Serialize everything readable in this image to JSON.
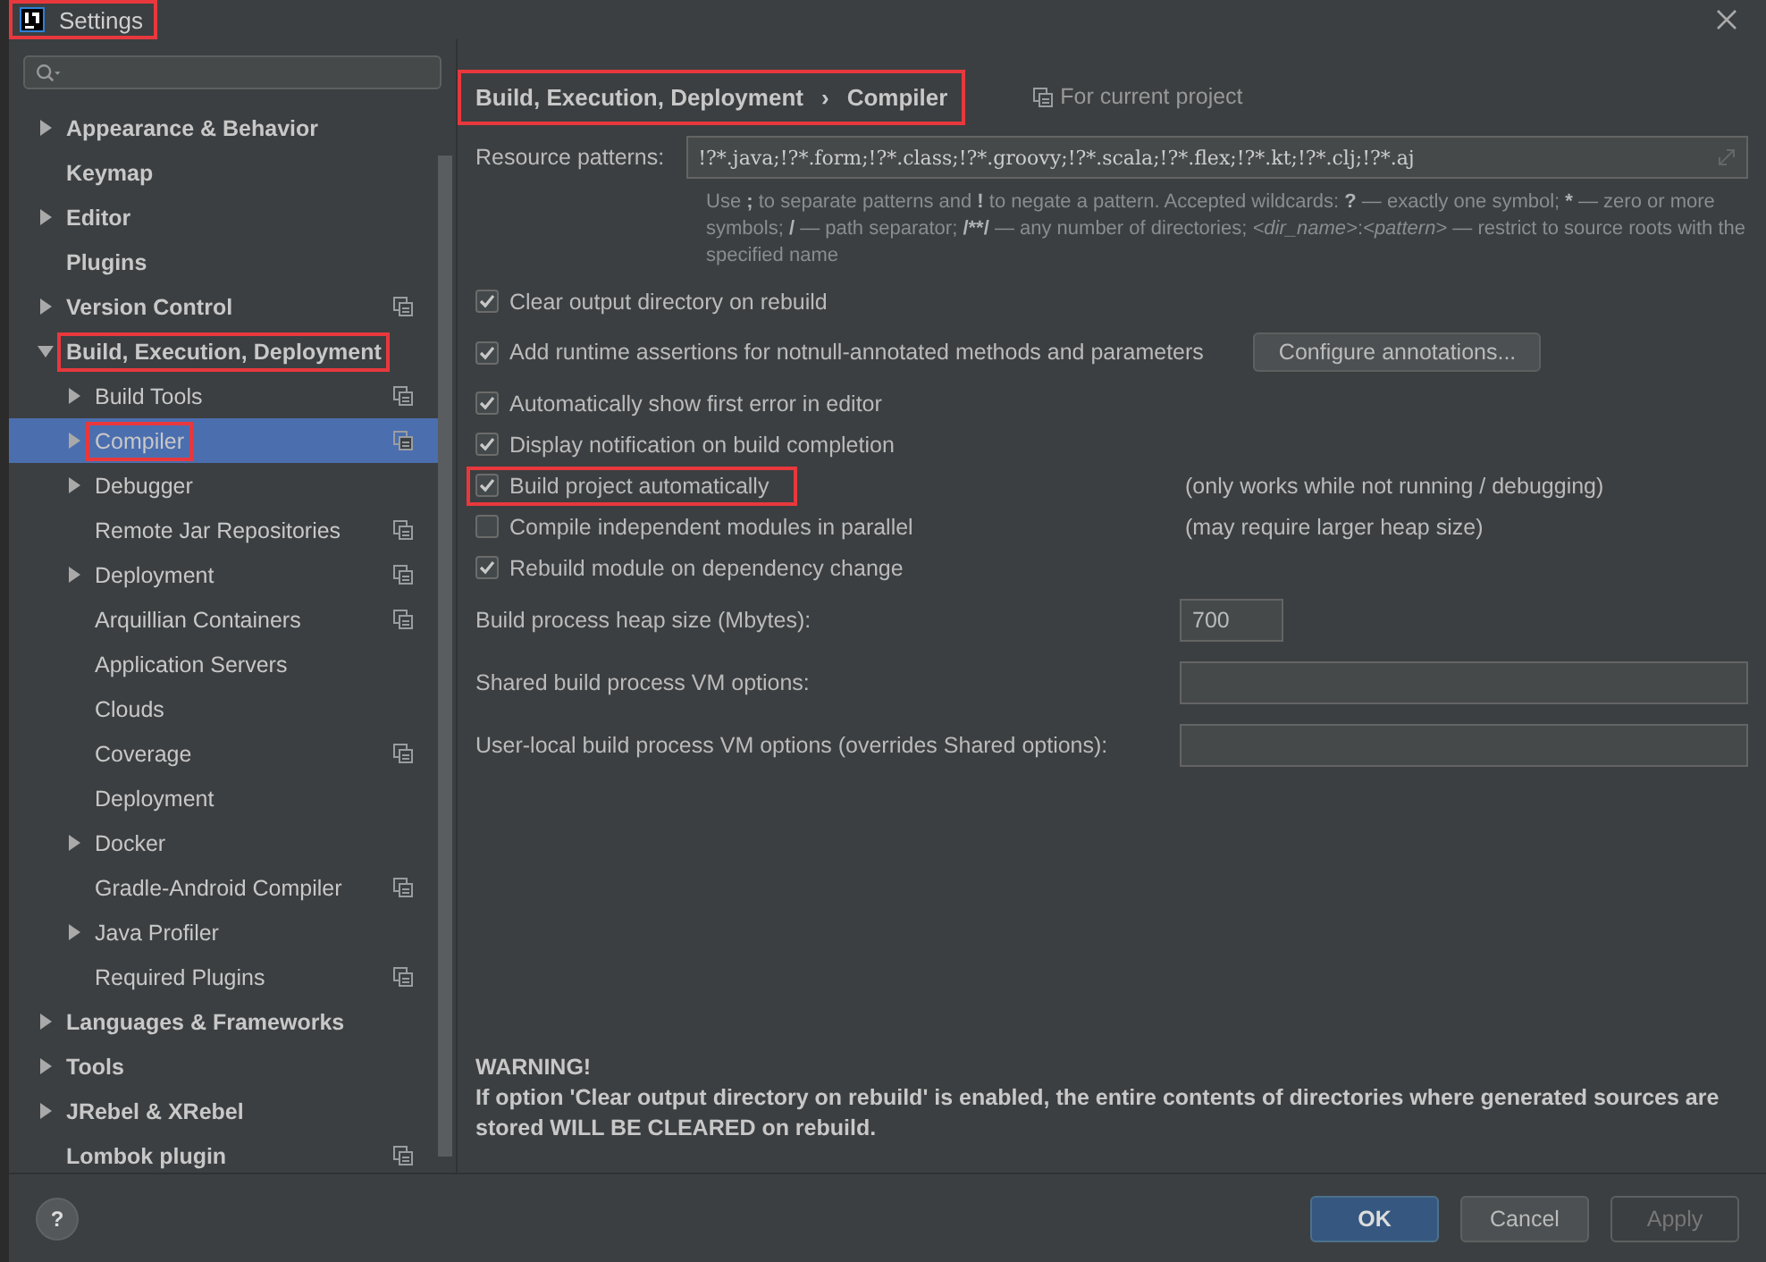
{
  "window": {
    "title": "Settings",
    "title_highlighted": true
  },
  "tree": [
    {
      "label": "Appearance & Behavior",
      "expandable": true,
      "expanded": false,
      "project_scope": false,
      "selected": false,
      "highlighted": false
    },
    {
      "label": "Keymap",
      "expandable": false,
      "project_scope": false,
      "selected": false,
      "highlighted": false
    },
    {
      "label": "Editor",
      "expandable": true,
      "expanded": false,
      "project_scope": false,
      "selected": false,
      "highlighted": false
    },
    {
      "label": "Plugins",
      "expandable": false,
      "project_scope": false,
      "selected": false,
      "highlighted": false
    },
    {
      "label": "Version Control",
      "expandable": true,
      "expanded": false,
      "project_scope": true,
      "selected": false,
      "highlighted": false
    },
    {
      "label": "Build, Execution, Deployment",
      "expandable": true,
      "expanded": true,
      "project_scope": false,
      "selected": false,
      "highlighted": true,
      "children": [
        {
          "label": "Build Tools",
          "expandable": true,
          "expanded": false,
          "project_scope": true,
          "selected": false,
          "highlighted": false
        },
        {
          "label": "Compiler",
          "expandable": true,
          "expanded": false,
          "project_scope": true,
          "selected": true,
          "highlighted": true
        },
        {
          "label": "Debugger",
          "expandable": true,
          "expanded": false,
          "project_scope": false,
          "selected": false,
          "highlighted": false
        },
        {
          "label": "Remote Jar Repositories",
          "expandable": false,
          "project_scope": true,
          "selected": false,
          "highlighted": false
        },
        {
          "label": "Deployment",
          "expandable": true,
          "expanded": false,
          "project_scope": true,
          "selected": false,
          "highlighted": false
        },
        {
          "label": "Arquillian Containers",
          "expandable": false,
          "project_scope": true,
          "selected": false,
          "highlighted": false
        },
        {
          "label": "Application Servers",
          "expandable": false,
          "project_scope": false,
          "selected": false,
          "highlighted": false
        },
        {
          "label": "Clouds",
          "expandable": false,
          "project_scope": false,
          "selected": false,
          "highlighted": false
        },
        {
          "label": "Coverage",
          "expandable": false,
          "project_scope": true,
          "selected": false,
          "highlighted": false
        },
        {
          "label": "Deployment",
          "expandable": false,
          "project_scope": false,
          "selected": false,
          "highlighted": false
        },
        {
          "label": "Docker",
          "expandable": true,
          "expanded": false,
          "project_scope": false,
          "selected": false,
          "highlighted": false
        },
        {
          "label": "Gradle-Android Compiler",
          "expandable": false,
          "project_scope": true,
          "selected": false,
          "highlighted": false
        },
        {
          "label": "Java Profiler",
          "expandable": true,
          "expanded": false,
          "project_scope": false,
          "selected": false,
          "highlighted": false
        },
        {
          "label": "Required Plugins",
          "expandable": false,
          "project_scope": true,
          "selected": false,
          "highlighted": false
        }
      ]
    },
    {
      "label": "Languages & Frameworks",
      "expandable": true,
      "expanded": false,
      "project_scope": false,
      "selected": false,
      "highlighted": false
    },
    {
      "label": "Tools",
      "expandable": true,
      "expanded": false,
      "project_scope": false,
      "selected": false,
      "highlighted": false
    },
    {
      "label": "JRebel & XRebel",
      "expandable": true,
      "expanded": false,
      "project_scope": false,
      "selected": false,
      "highlighted": false
    },
    {
      "label": "Lombok plugin",
      "expandable": false,
      "project_scope": true,
      "selected": false,
      "highlighted": false
    }
  ],
  "breadcrumb": {
    "parts": [
      "Build, Execution, Deployment",
      "›",
      "Compiler"
    ],
    "highlighted": true
  },
  "scope_label": "For current project",
  "resource_patterns": {
    "label": "Resource patterns:",
    "value": "!?*.java;!?*.form;!?*.class;!?*.groovy;!?*.scala;!?*.flex;!?*.kt;!?*.clj;!?*.aj"
  },
  "hint": [
    {
      "kind": "plain",
      "text": "Use "
    },
    {
      "kind": "symbol",
      "text": ";"
    },
    {
      "kind": "plain",
      "text": " to separate patterns and "
    },
    {
      "kind": "symbol",
      "text": "!"
    },
    {
      "kind": "plain",
      "text": " to negate a pattern. Accepted wildcards: "
    },
    {
      "kind": "symbol",
      "text": "?"
    },
    {
      "kind": "plain",
      "text": " — exactly one symbol; "
    },
    {
      "kind": "symbol",
      "text": "*"
    },
    {
      "kind": "plain",
      "text": " — zero or more symbols; "
    },
    {
      "kind": "symbol",
      "text": "/"
    },
    {
      "kind": "plain",
      "text": " — path separator; "
    },
    {
      "kind": "symbol",
      "text": "/**/"
    },
    {
      "kind": "plain",
      "text": " — any number of directories; "
    },
    {
      "kind": "placeholder",
      "text": "<dir_name>"
    },
    {
      "kind": "plain",
      "text": ":"
    },
    {
      "kind": "placeholder",
      "text": "<pattern>"
    },
    {
      "kind": "plain",
      "text": " — restrict to source roots with the specified name"
    }
  ],
  "options": [
    {
      "label": "Clear output directory on rebuild",
      "checked": true,
      "highlighted": false
    },
    {
      "label": "Add runtime assertions for notnull-annotated methods and parameters",
      "checked": true,
      "highlighted": false,
      "button": "Configure annotations..."
    },
    {
      "label": "Automatically show first error in editor",
      "checked": true,
      "highlighted": false
    },
    {
      "label": "Display notification on build completion",
      "checked": true,
      "highlighted": false
    },
    {
      "label": "Build project automatically",
      "checked": true,
      "highlighted": true,
      "note": "(only works while not running / debugging)"
    },
    {
      "label": "Compile independent modules in parallel",
      "checked": false,
      "highlighted": false,
      "note": "(may require larger heap size)"
    },
    {
      "label": "Rebuild module on dependency change",
      "checked": true,
      "highlighted": false
    }
  ],
  "fields": [
    {
      "label": "Build process heap size (Mbytes):",
      "value": "700",
      "kind": "short"
    },
    {
      "label": "Shared build process VM options:",
      "kind": "wide"
    },
    {
      "label": "User-local build process VM options (overrides Shared options):",
      "kind": "wide"
    }
  ],
  "warning": {
    "title": "WARNING!",
    "text": "If option 'Clear output directory on rebuild' is enabled, the entire contents of directories where generated sources are stored WILL BE CLEARED on rebuild."
  },
  "help_button": "?",
  "buttons": [
    {
      "label": "OK",
      "kind": "primary",
      "disabled": false
    },
    {
      "label": "Cancel",
      "kind": "normal",
      "disabled": false
    },
    {
      "label": "Apply",
      "kind": "normal",
      "disabled": true
    }
  ]
}
